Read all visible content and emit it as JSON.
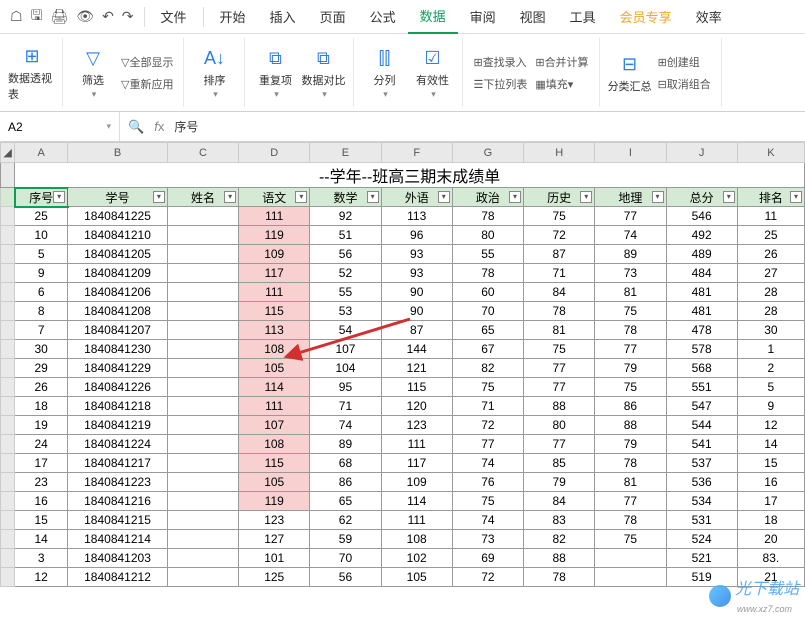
{
  "menu": {
    "file": "文件",
    "start": "开始",
    "insert": "插入",
    "page": "页面",
    "formula": "公式",
    "data": "数据",
    "review": "审阅",
    "view": "视图",
    "tools": "工具",
    "member": "会员专享",
    "efficiency": "效率"
  },
  "ribbon": {
    "pivot": "数据透视表",
    "filter": "筛选",
    "show_all": "全部显示",
    "reapply": "重新应用",
    "sort": "排序",
    "dup": "重复项",
    "compare": "数据对比",
    "split": "分列",
    "validity": "有效性",
    "dropdown": "下拉列表",
    "fill": "填充",
    "lookup": "查找录入",
    "consolidate": "合并计算",
    "subtotal": "分类汇总",
    "create_group": "创建组",
    "ungroup": "取消组合"
  },
  "formula_bar": {
    "cell": "A2",
    "value": "序号"
  },
  "columns": [
    "A",
    "B",
    "C",
    "D",
    "E",
    "F",
    "G",
    "H",
    "I",
    "J",
    "K"
  ],
  "title": "--学年--班高三期末成绩单",
  "headers": [
    "序号",
    "学号",
    "姓名",
    "语文",
    "数学",
    "外语",
    "政治",
    "历史",
    "地理",
    "总分",
    "排名"
  ],
  "rows": [
    {
      "c": [
        "25",
        "1840841225",
        "",
        "111",
        "92",
        "113",
        "78",
        "75",
        "77",
        "546",
        "11"
      ],
      "hl": true
    },
    {
      "c": [
        "10",
        "1840841210",
        "",
        "119",
        "51",
        "96",
        "80",
        "72",
        "74",
        "492",
        "25"
      ],
      "hl": true
    },
    {
      "c": [
        "5",
        "1840841205",
        "",
        "109",
        "56",
        "93",
        "55",
        "87",
        "89",
        "489",
        "26"
      ],
      "hl": true
    },
    {
      "c": [
        "9",
        "1840841209",
        "",
        "117",
        "52",
        "93",
        "78",
        "71",
        "73",
        "484",
        "27"
      ],
      "hl": true
    },
    {
      "c": [
        "6",
        "1840841206",
        "",
        "111",
        "55",
        "90",
        "60",
        "84",
        "81",
        "481",
        "28"
      ],
      "hl": true
    },
    {
      "c": [
        "8",
        "1840841208",
        "",
        "115",
        "53",
        "90",
        "70",
        "78",
        "75",
        "481",
        "28"
      ],
      "hl": true
    },
    {
      "c": [
        "7",
        "1840841207",
        "",
        "113",
        "54",
        "87",
        "65",
        "81",
        "78",
        "478",
        "30"
      ],
      "hl": true
    },
    {
      "c": [
        "30",
        "1840841230",
        "",
        "108",
        "107",
        "144",
        "67",
        "75",
        "77",
        "578",
        "1"
      ],
      "hl": true
    },
    {
      "c": [
        "29",
        "1840841229",
        "",
        "105",
        "104",
        "121",
        "82",
        "77",
        "79",
        "568",
        "2"
      ],
      "hl": true
    },
    {
      "c": [
        "26",
        "1840841226",
        "",
        "114",
        "95",
        "115",
        "75",
        "77",
        "75",
        "551",
        "5"
      ],
      "hl": true
    },
    {
      "c": [
        "18",
        "1840841218",
        "",
        "111",
        "71",
        "120",
        "71",
        "88",
        "86",
        "547",
        "9"
      ],
      "hl": true
    },
    {
      "c": [
        "19",
        "1840841219",
        "",
        "107",
        "74",
        "123",
        "72",
        "80",
        "88",
        "544",
        "12"
      ],
      "hl": true
    },
    {
      "c": [
        "24",
        "1840841224",
        "",
        "108",
        "89",
        "111",
        "77",
        "77",
        "79",
        "541",
        "14"
      ],
      "hl": true
    },
    {
      "c": [
        "17",
        "1840841217",
        "",
        "115",
        "68",
        "117",
        "74",
        "85",
        "78",
        "537",
        "15"
      ],
      "hl": true
    },
    {
      "c": [
        "23",
        "1840841223",
        "",
        "105",
        "86",
        "109",
        "76",
        "79",
        "81",
        "536",
        "16"
      ],
      "hl": true
    },
    {
      "c": [
        "16",
        "1840841216",
        "",
        "119",
        "65",
        "114",
        "75",
        "84",
        "77",
        "534",
        "17"
      ],
      "hl": true
    },
    {
      "c": [
        "15",
        "1840841215",
        "",
        "123",
        "62",
        "111",
        "74",
        "83",
        "78",
        "531",
        "18"
      ],
      "hl": false
    },
    {
      "c": [
        "14",
        "1840841214",
        "",
        "127",
        "59",
        "108",
        "73",
        "82",
        "75",
        "524",
        "20"
      ],
      "hl": false
    },
    {
      "c": [
        "3",
        "1840841203",
        "",
        "101",
        "70",
        "102",
        "69",
        "88",
        "521",
        "83.",
        "",
        ""
      ],
      "hl": false,
      "special": true
    },
    {
      "c": [
        "12",
        "1840841212",
        "",
        "125",
        "56",
        "105",
        "72",
        "78",
        "",
        "519",
        "21"
      ],
      "hl": false,
      "special2": true
    }
  ],
  "row3": {
    "c": [
      "3",
      "1840841203",
      "",
      "101",
      "70",
      "102",
      "69",
      "88",
      "",
      "521",
      "83."
    ]
  },
  "row12": {
    "c": [
      "12",
      "1840841212",
      "",
      "125",
      "56",
      "105",
      "72",
      "78",
      "",
      "519",
      "21"
    ]
  },
  "watermark": {
    "main": "光下载站",
    "sub": "www.xz7.com"
  },
  "chart_data": null
}
